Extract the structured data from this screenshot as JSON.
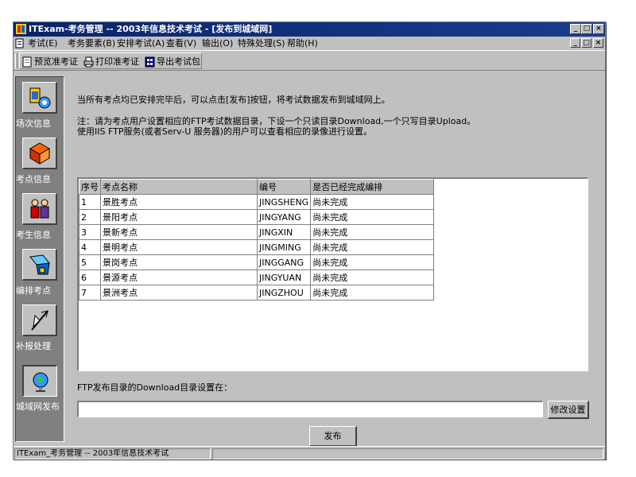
{
  "window": {
    "title": "ITExam-考务管理 -- 2003年信息技术考试 - [发布到城域网]",
    "min_glyph": "_",
    "max_glyph": "□",
    "close_glyph": "×"
  },
  "menubar": {
    "items": [
      "考试(E)",
      "考务要素(B)",
      "安排考试(A)",
      "查看(V)",
      "输出(O)",
      "特殊处理(S)",
      "帮助(H)"
    ]
  },
  "toolbar": {
    "buttons": [
      "预览准考证",
      "打印准考证",
      "导出考试包"
    ]
  },
  "sidebar": {
    "items": [
      {
        "label": "场次信息",
        "icon": "sessions-icon"
      },
      {
        "label": "考点信息",
        "icon": "exam-sites-icon"
      },
      {
        "label": "考生信息",
        "icon": "candidates-icon"
      },
      {
        "label": "编排考点",
        "icon": "arrange-icon"
      },
      {
        "label": "补报处理",
        "icon": "supplement-icon"
      },
      {
        "label": "城域网发布",
        "icon": "publish-globe-icon"
      }
    ]
  },
  "main": {
    "intro": "当所有考点均已安排完毕后，可以点击[发布]按钮，将考试数据发布到城域网上。",
    "note_line1": "注：请为考点用户设置相应的FTP考试数据目录，下设一个只读目录Download,一个只写目录Upload。",
    "note_line2": "使用IIS FTP服务(或者Serv-U 服务器)的用户可以查看相应的录像进行设置。",
    "table": {
      "columns": [
        "序号",
        "考点名称",
        "编号",
        "是否已经完成编排"
      ],
      "rows": [
        [
          "1",
          "景胜考点",
          "JINGSHENG",
          "尚未完成"
        ],
        [
          "2",
          "景阳考点",
          "JINGYANG",
          "尚未完成"
        ],
        [
          "3",
          "景新考点",
          "JINGXIN",
          "尚未完成"
        ],
        [
          "4",
          "景明考点",
          "JINGMING",
          "尚未完成"
        ],
        [
          "5",
          "景岗考点",
          "JINGGANG",
          "尚未完成"
        ],
        [
          "6",
          "景源考点",
          "JINGYUAN",
          "尚未完成"
        ],
        [
          "7",
          "景洲考点",
          "JINGZHOU",
          "尚未完成"
        ]
      ]
    },
    "ftp_label": "FTP发布目录的Download目录设置在：",
    "ftp_value": "",
    "modify_button": "修改设置",
    "publish_button": "发布"
  },
  "statusbar": {
    "text": "ITExam_考务管理 -- 2003年信息技术考试"
  }
}
